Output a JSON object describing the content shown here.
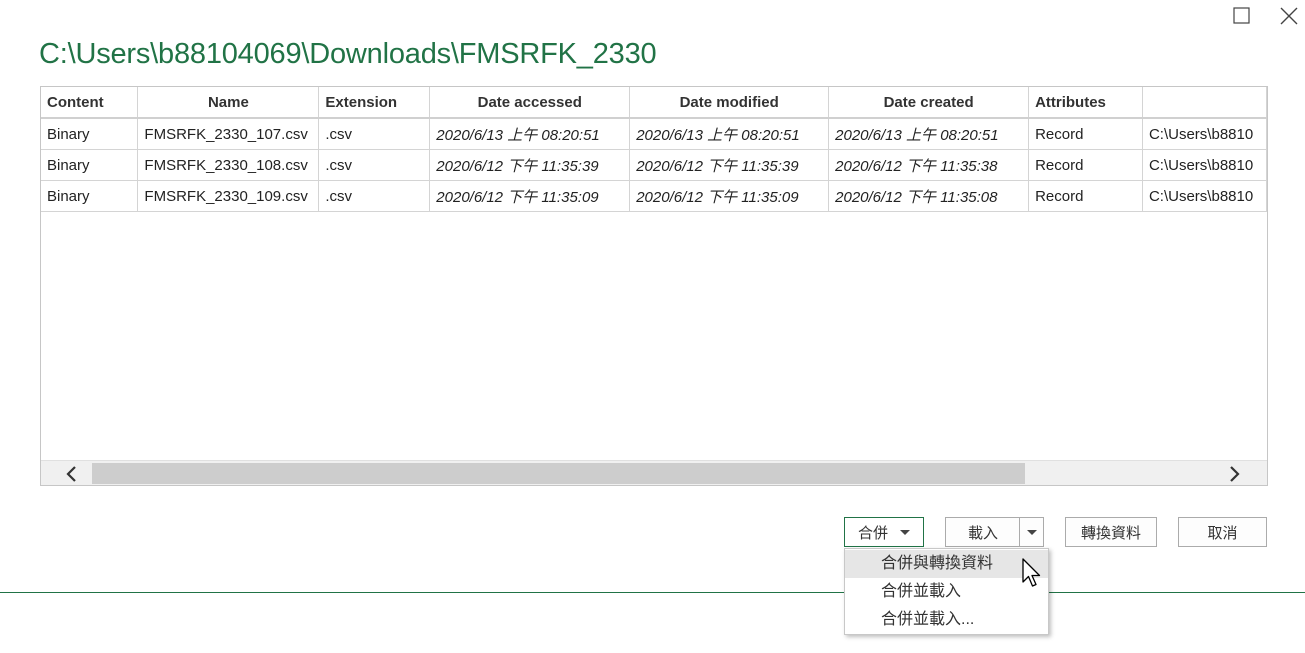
{
  "window": {
    "title": "C:\\Users\\b88104069\\Downloads\\FMSRFK_2330"
  },
  "table": {
    "columns": [
      "Content",
      "Name",
      "Extension",
      "Date accessed",
      "Date modified",
      "Date created",
      "Attributes",
      ""
    ],
    "rows": [
      [
        "Binary",
        "FMSRFK_2330_107.csv",
        ".csv",
        "2020/6/13 上午 08:20:51",
        "2020/6/13 上午 08:20:51",
        "2020/6/13 上午 08:20:51",
        "Record",
        "C:\\Users\\b8810"
      ],
      [
        "Binary",
        "FMSRFK_2330_108.csv",
        ".csv",
        "2020/6/12 下午 11:35:39",
        "2020/6/12 下午 11:35:39",
        "2020/6/12 下午 11:35:38",
        "Record",
        "C:\\Users\\b8810"
      ],
      [
        "Binary",
        "FMSRFK_2330_109.csv",
        ".csv",
        "2020/6/12 下午 11:35:09",
        "2020/6/12 下午 11:35:09",
        "2020/6/12 下午 11:35:08",
        "Record",
        "C:\\Users\\b8810"
      ]
    ]
  },
  "buttons": {
    "combine": "合併",
    "load": "載入",
    "transform": "轉換資料",
    "cancel": "取消"
  },
  "menu": {
    "items": [
      "合併與轉換資料",
      "合併並載入",
      "合併並載入..."
    ]
  },
  "colors": {
    "accent": "#217346"
  }
}
